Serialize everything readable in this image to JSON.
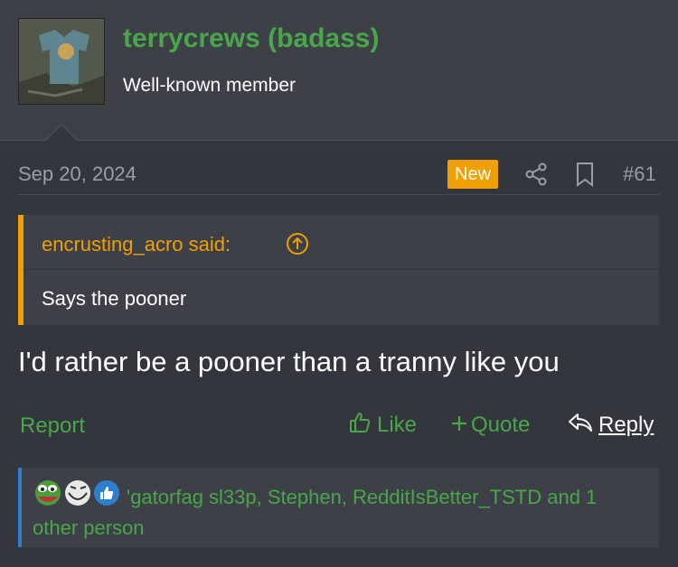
{
  "user": {
    "name": "terrycrews (badass)",
    "title": "Well-known member"
  },
  "post_meta": {
    "date": "Sep 20, 2024",
    "badge": "New",
    "number": "#61"
  },
  "quote": {
    "attribution": "encrusting_acro said:",
    "text": "Says the pooner"
  },
  "post": {
    "body": "I'd rather be a pooner than a tranny like you"
  },
  "actions": {
    "report": "Report",
    "like": "Like",
    "quote": "Quote",
    "reply": "Reply"
  },
  "reactions": {
    "summary": "'gatorfag sl33p, Stephen, RedditIsBetter_TSTD and 1 other person"
  },
  "colors": {
    "accent_green": "#4aa64a",
    "quote_orange": "#f0a000",
    "reaction_blue": "#2f7fcf"
  }
}
